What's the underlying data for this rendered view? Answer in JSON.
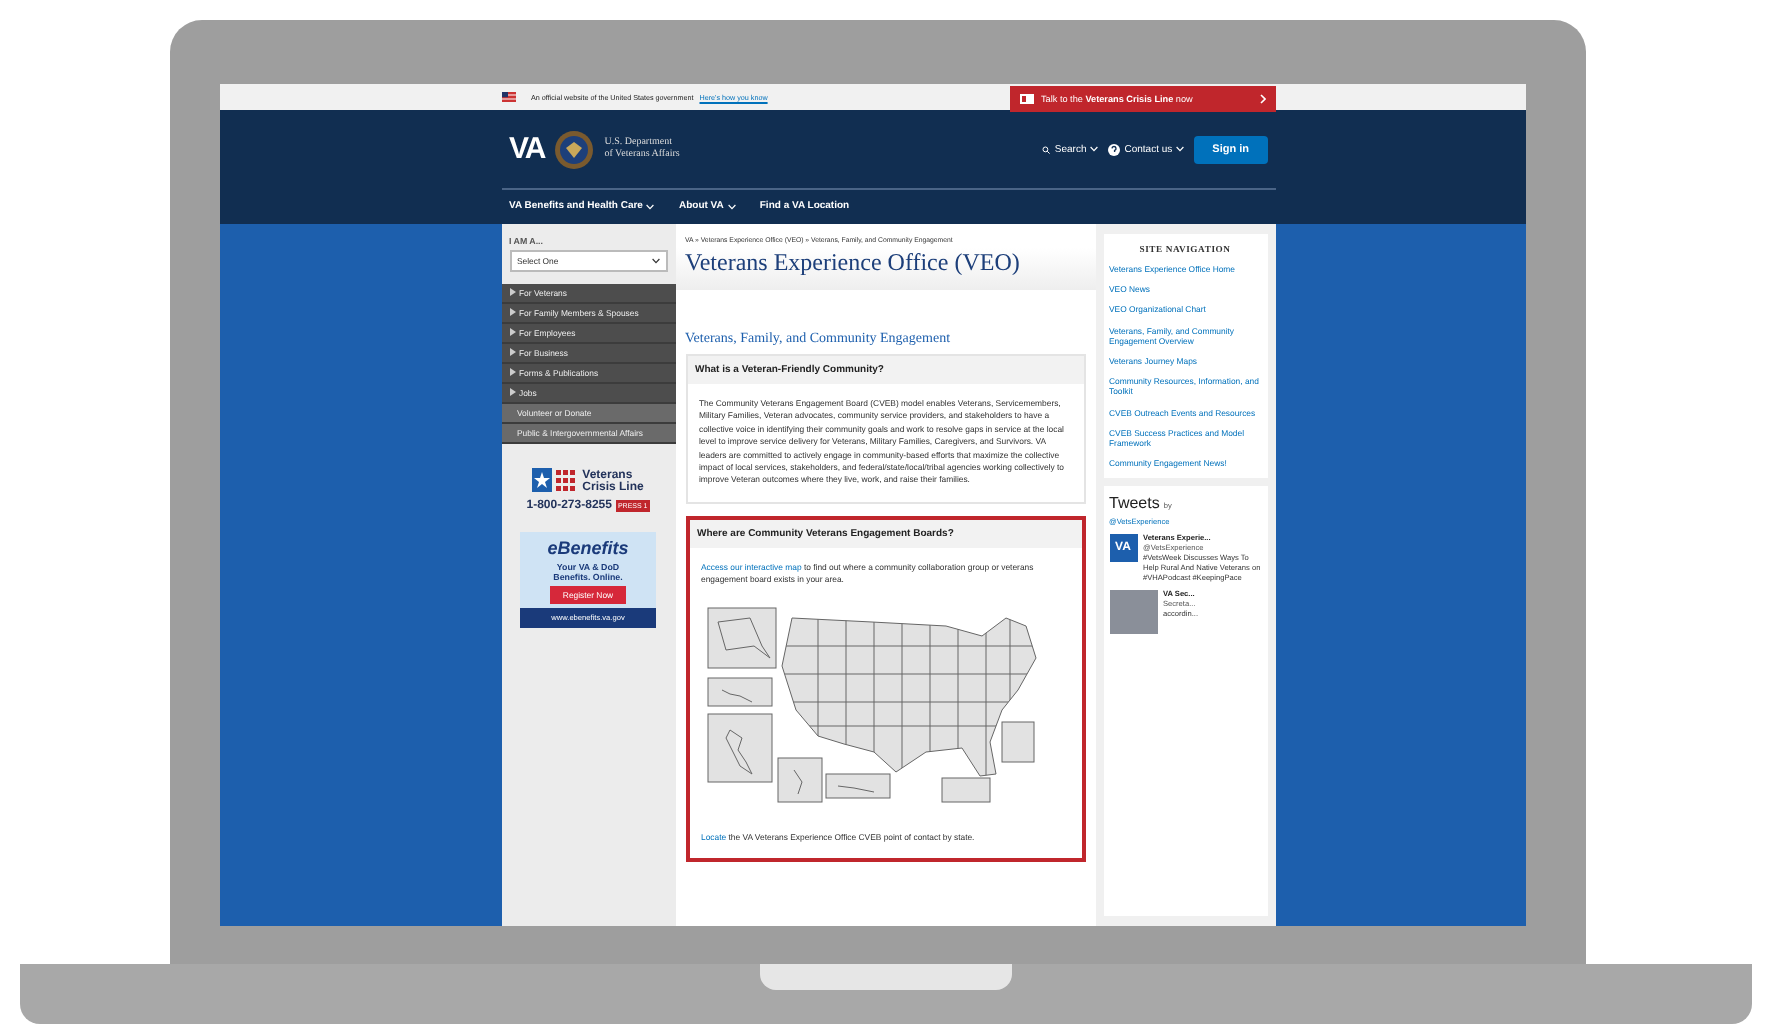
{
  "gov_banner": {
    "text": "An official website of the United States government",
    "link": "Here's how you know"
  },
  "crisis_button": {
    "label": "Talk to the **Veterans Crisis Line** now"
  },
  "header": {
    "logo": "VA",
    "department": [
      "U.S. Department",
      "of Veterans Affairs"
    ],
    "search": "Search",
    "contact": "Contact us",
    "sign_in": "Sign in"
  },
  "nav": [
    {
      "label": "VA Benefits and Health Care",
      "has_menu": true
    },
    {
      "label": "About VA",
      "has_menu": true
    },
    {
      "label": "Find a VA Location",
      "has_menu": false
    }
  ],
  "sidebar": {
    "label": "I AM A...",
    "select": "Select One",
    "items": [
      {
        "label": "For Veterans",
        "kind": "primary"
      },
      {
        "label": "For Family Members & Spouses",
        "kind": "primary"
      },
      {
        "label": "For Employees",
        "kind": "primary"
      },
      {
        "label": "For Business",
        "kind": "primary"
      },
      {
        "label": "Forms & Publications",
        "kind": "primary"
      },
      {
        "label": "Jobs",
        "kind": "primary"
      },
      {
        "label": "Volunteer or Donate",
        "kind": "secondary"
      },
      {
        "label": "Public & Intergovernmental Affairs",
        "kind": "secondary"
      }
    ],
    "crisis_line": {
      "name": [
        "Veterans",
        "Crisis Line"
      ],
      "phone": "1-800-273-8255",
      "press": "PRESS 1"
    },
    "ebenefits": {
      "logo": "eBenefits",
      "tagline": "Your VA & DoD Benefits. Online.",
      "button": "Register Now",
      "url": "www.ebenefits.va.gov"
    }
  },
  "main": {
    "breadcrumb": "VA » Veterans Experience Office (VEO) » Veterans, Family, and Community Engagement",
    "title": "Veterans Experience Office (VEO)",
    "subtitle": "Veterans, Family, and Community Engagement",
    "about": {
      "heading": "What is a Veteran-Friendly Community?",
      "text": "The Community Veterans Engagement Board (CVEB) model enables Veterans, Servicemembers, Military Families, Veteran advocates, community service providers, and stakeholders to have a collective voice in identifying their community goals and work to resolve gaps in service at the local level to improve service delivery for Veterans, Military Families, Caregivers, and Survivors. VA leaders are committed to actively engage in community-based efforts that maximize the collective impact of local services, stakeholders, and federal/state/local/tribal agencies working collectively to improve Veteran outcomes where they live, work, and raise their families."
    },
    "boards": {
      "heading": "Where are Community Veterans Engagement Boards?",
      "link": "Access our interactive map",
      "text": " to find out where a community collaboration group or veterans engagement board exists in your area.",
      "locate_link": "Locate",
      "locate_text": " the VA Veterans Experience Office CVEB point of contact by state."
    }
  },
  "site_nav": {
    "title": "SITE NAVIGATION",
    "links": [
      "Veterans Experience Office Home",
      "VEO News",
      "VEO Organizational Chart",
      "Veterans, Family, and Community Engagement Overview",
      "Veterans Journey Maps",
      "Community Resources, Information, and Toolkit",
      "CVEB Outreach Events and Resources",
      "CVEB Success Practices and Model Framework",
      "Community Engagement News!"
    ]
  },
  "tweets": {
    "title": "Tweets",
    "by": "by",
    "handle": "@VetsExperience",
    "items": [
      {
        "avatar": "VA",
        "author": "Veterans Experie...",
        "handle": "@VetsExperience",
        "text": "#VetsWeek Discusses Ways To Help Rural And Native Veterans on #VHAPodcast #KeepingPace"
      },
      {
        "author": "VA Sec...",
        "handle": "Secreta...",
        "text": "accordin..."
      }
    ]
  }
}
